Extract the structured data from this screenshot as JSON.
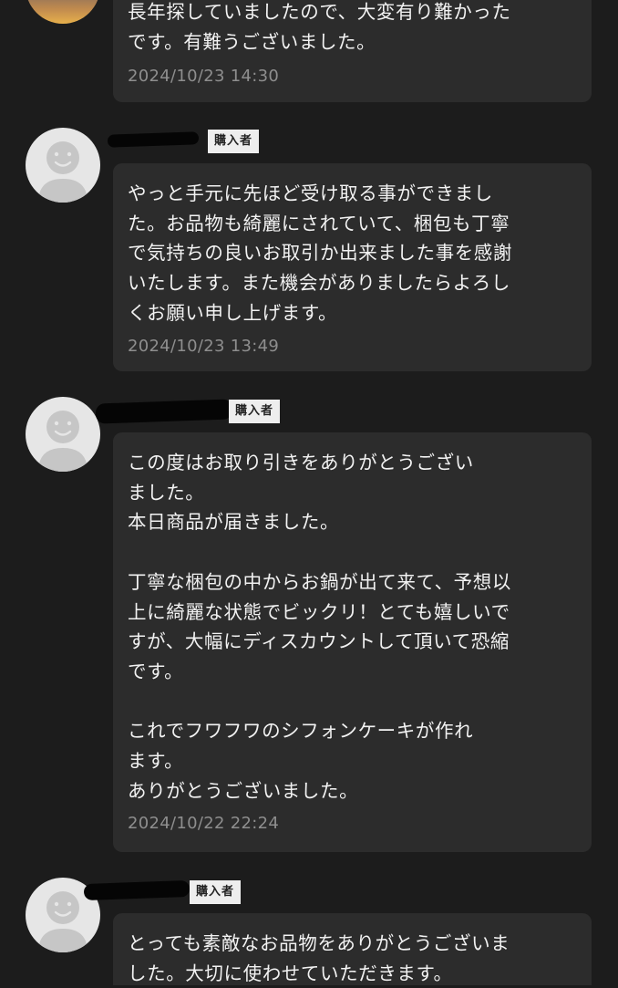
{
  "reviews": [
    {
      "badge": "",
      "message": "長年探していましたので、大変有り難かった\nです。有難うございました。",
      "timestamp": "2024/10/23 14:30"
    },
    {
      "badge": "購入者",
      "message": "やっと手元に先ほど受け取る事ができまし\nた。お品物も綺麗にされていて、梱包も丁寧\nで気持ちの良いお取引か出来ました事を感謝\nいたします。また機会がありましたらよろし\nくお願い申し上げます。",
      "timestamp": "2024/10/23 13:49"
    },
    {
      "badge": "購入者",
      "message": "この度はお取り引きをありがとうござい\nました。\n本日商品が届きました。\n\n丁寧な梱包の中からお鍋が出て来て、予想以\n上に綺麗な状態でビックリ！とても嬉しいで\nすが、大幅にディスカウントして頂いて恐縮\nです。\n\nこれでフワフワのシフォンケーキが作れ\nます。\nありがとうございました。",
      "timestamp": "2024/10/22 22:24"
    },
    {
      "badge": "購入者",
      "message": "とっても素敵なお品物をありがとうございま\nした。大切に使わせていただきます。",
      "timestamp": ""
    }
  ],
  "icons": {
    "user_avatar": "default-user-avatar-icon",
    "photo_avatar": "user-photo-avatar"
  },
  "colors": {
    "background": "#1c1c1c",
    "bubble": "#2c2c2c",
    "text": "#f2f2f2",
    "timestamp": "#8e8e8e",
    "badge_bg": "#eeeeee"
  }
}
